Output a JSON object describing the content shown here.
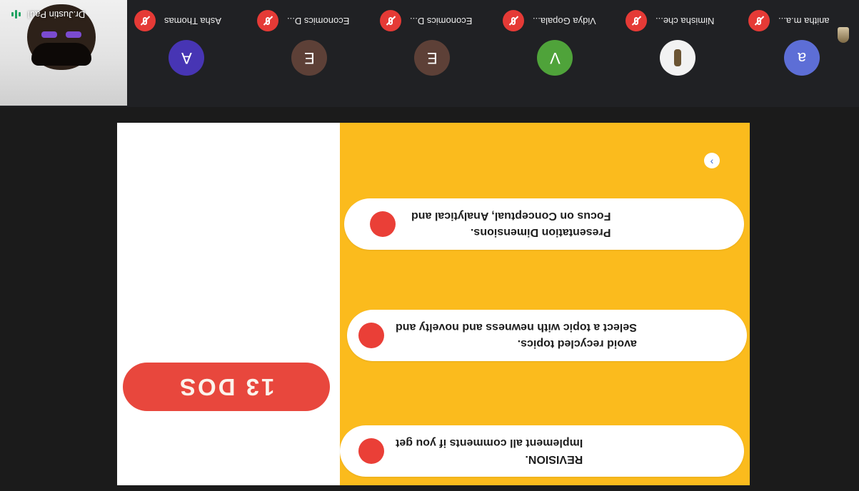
{
  "meeting": {
    "self": {
      "name": "Dr.Justin Paul"
    },
    "participants": [
      {
        "name": "Asha Thomas",
        "initial": "A",
        "color": "#4735b4",
        "muted": true
      },
      {
        "name": "Economics D...",
        "initial": "E",
        "color": "#5d4037",
        "muted": true
      },
      {
        "name": "Economics D...",
        "initial": "E",
        "color": "#5d4037",
        "muted": true
      },
      {
        "name": "Vidya Gopala...",
        "initial": "V",
        "color": "#4fa33a",
        "muted": true
      },
      {
        "name": "Nimisha che...",
        "initial": "",
        "color": "#f2f2f2",
        "muted": true,
        "photo": true
      },
      {
        "name": "anitha m.a...",
        "initial": "a",
        "color": "#5d6ed6",
        "muted": true
      }
    ]
  },
  "slide": {
    "title": "13 DOS",
    "items": [
      {
        "line1": "Presentation Dimensions.",
        "line2": "Focus on Conceptual, Analytical and"
      },
      {
        "line1": "avoid recycled topics.",
        "line2": "Select a topic with newness and novelty and"
      },
      {
        "line1": "REVISION.",
        "line2": "Implement all comments if you get"
      }
    ],
    "colors": {
      "accent": "#e8473d",
      "panel": "#fbbb1d",
      "bullet": "#ea3f37"
    }
  }
}
